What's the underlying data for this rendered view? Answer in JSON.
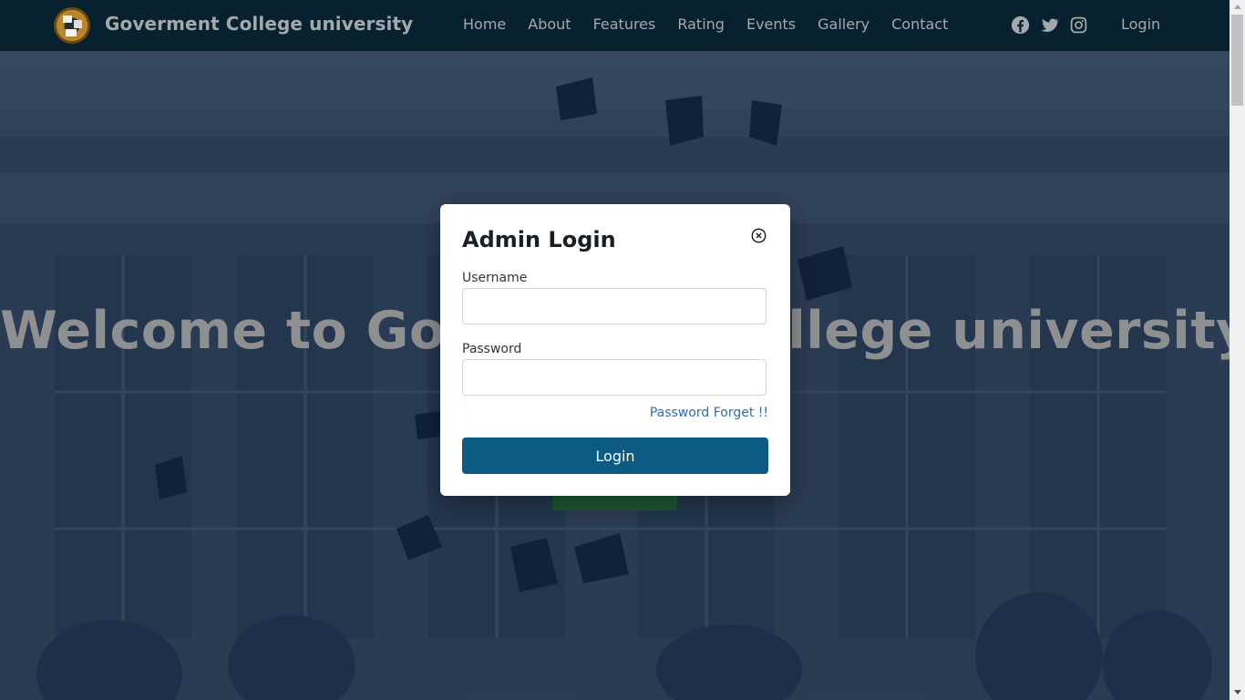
{
  "navbar": {
    "brand": "Goverment College university",
    "links": [
      "Home",
      "About",
      "Features",
      "Rating",
      "Events",
      "Gallery",
      "Contact"
    ],
    "social_icons": [
      "facebook-icon",
      "twitter-icon",
      "instagram-icon"
    ],
    "login": "Login"
  },
  "hero": {
    "headline": "Welcome to Goverment College university"
  },
  "modal": {
    "title": "Admin Login",
    "username_label": "Username",
    "username_value": "",
    "password_label": "Password",
    "password_value": "",
    "forgot_link": "Password Forget !!",
    "submit_label": "Login",
    "close_icon": "close-circle-icon"
  },
  "colors": {
    "navbar_bg": "#07212f",
    "login_button": "#0d5a85",
    "forgot_link": "#2f6eb0",
    "hero_overlay": "#0a203e"
  }
}
